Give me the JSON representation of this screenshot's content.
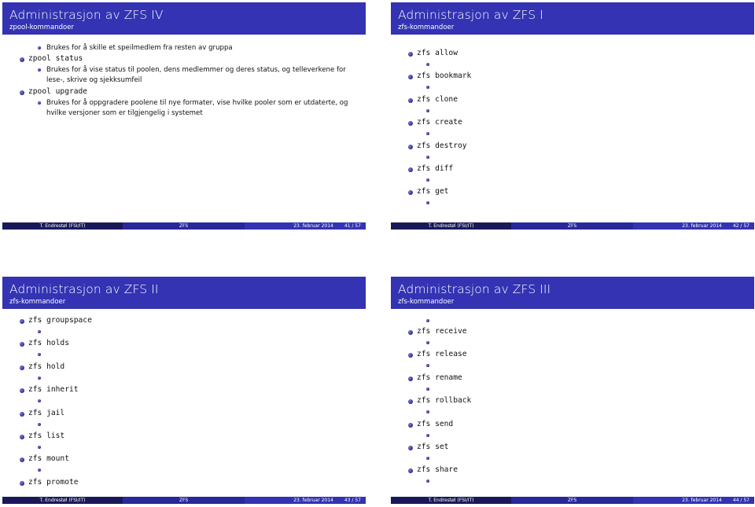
{
  "footer": {
    "author": "T. Endrestøl  (FSI/IT)",
    "topic": "ZFS",
    "date": "23. februar 2014",
    "total_pages": "57"
  },
  "slides": [
    {
      "title": "Administrasjon av ZFS IV",
      "subtitle": "zpool-kommandoer",
      "page": "41",
      "items": [
        {
          "level": 2,
          "text": "Brukes for å skille et speilmedlem fra resten av gruppa"
        },
        {
          "level": 1,
          "text": "zpool status",
          "mono": true
        },
        {
          "level": 2,
          "text": "Brukes for å vise status til poolen, dens medlemmer og deres status, og telleverkene for lese-, skrive og sjekksumfeil"
        },
        {
          "level": 1,
          "text": "zpool upgrade",
          "mono": true
        },
        {
          "level": 2,
          "text": "Brukes for å oppgradere poolene til nye formater, vise hvilke pooler som er utdaterte, og hvilke versjoner som er tilgjengelig i systemet"
        }
      ]
    },
    {
      "title": "Administrasjon av ZFS I",
      "subtitle": "zfs-kommandoer",
      "page": "42",
      "commands": [
        "zfs allow",
        "zfs bookmark",
        "zfs clone",
        "zfs create",
        "zfs destroy",
        "zfs diff",
        "zfs get"
      ]
    },
    {
      "title": "Administrasjon av ZFS II",
      "subtitle": "zfs-kommandoer",
      "page": "43",
      "commands": [
        "zfs groupspace",
        "zfs holds",
        "zfs hold",
        "zfs inherit",
        "zfs jail",
        "zfs list",
        "zfs mount",
        "zfs promote"
      ]
    },
    {
      "title": "Administrasjon av ZFS III",
      "subtitle": "zfs-kommandoer",
      "page": "44",
      "commands": [
        "zfs receive",
        "zfs release",
        "zfs rename",
        "zfs rollback",
        "zfs send",
        "zfs set",
        "zfs share"
      ]
    }
  ]
}
